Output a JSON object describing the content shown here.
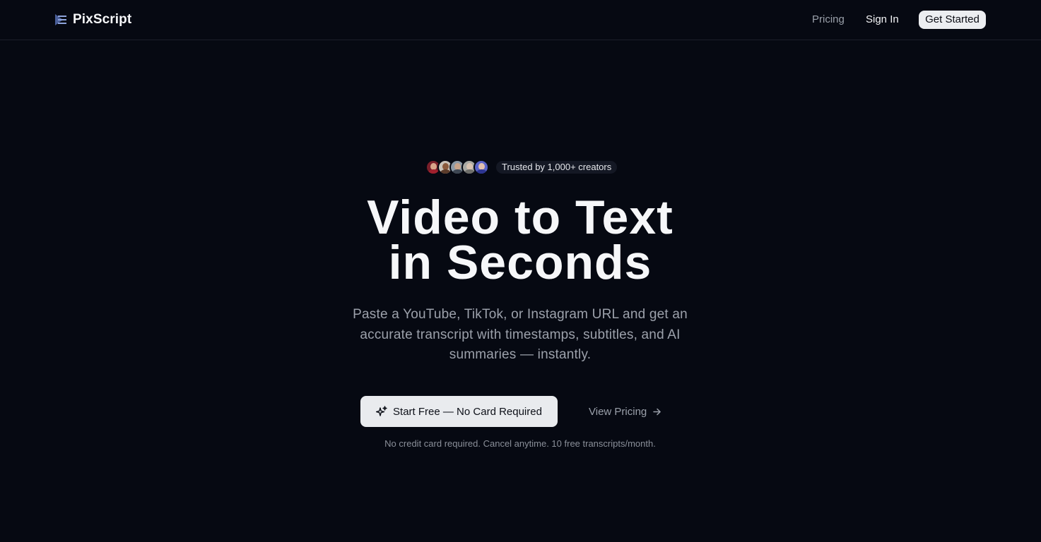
{
  "nav": {
    "brand": "PixScript",
    "brand_icon": "play-lines-icon",
    "pricing": "Pricing",
    "sign_in": "Sign In",
    "get_started": "Get Started"
  },
  "hero": {
    "trust_text": "Trusted by 1,000+ creators",
    "headline_line1": "Video to Text",
    "headline_line2": "in Seconds",
    "subtitle": "Paste a YouTube, TikTok, or Instagram URL and get an accurate transcript with timestamps, subtitles, and AI summaries — instantly.",
    "primary_cta": "Start Free — No Card Required",
    "primary_cta_icon": "sparkle-icon",
    "secondary_cta": "View Pricing",
    "secondary_cta_icon": "arrow-right-icon",
    "fineprint": "No credit card required. Cancel anytime. 10 free transcripts/month."
  },
  "colors": {
    "background": "#060912",
    "text": "#f6f7f9",
    "muted": "#9aa0aa",
    "button_bg": "#e9ebee",
    "brand_accent": "#6f86c9"
  }
}
